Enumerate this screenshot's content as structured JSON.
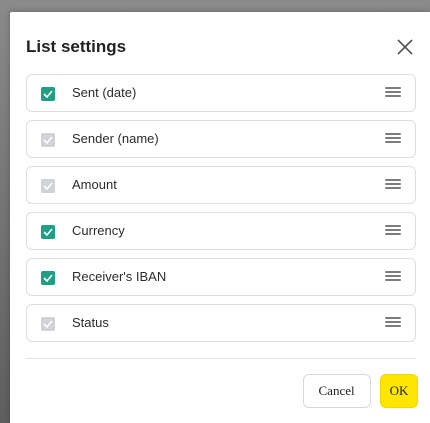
{
  "dialog": {
    "title": "List settings",
    "close_icon": "close-icon"
  },
  "columns": [
    {
      "label": "Sent (date)",
      "checked": true,
      "disabled": false
    },
    {
      "label": "Sender (name)",
      "checked": true,
      "disabled": true
    },
    {
      "label": "Amount",
      "checked": true,
      "disabled": true
    },
    {
      "label": "Currency",
      "checked": true,
      "disabled": false
    },
    {
      "label": "Receiver's IBAN",
      "checked": true,
      "disabled": false
    },
    {
      "label": "Status",
      "checked": true,
      "disabled": true
    }
  ],
  "footer": {
    "cancel_label": "Cancel",
    "ok_label": "OK"
  },
  "colors": {
    "checkbox_checked": "#1f9f86",
    "checkbox_disabled": "#cfd3d6",
    "ok_button": "#ffe600"
  },
  "icons": {
    "row_checkbox": "checkmark-icon",
    "row_handle": "drag-handle-icon"
  }
}
